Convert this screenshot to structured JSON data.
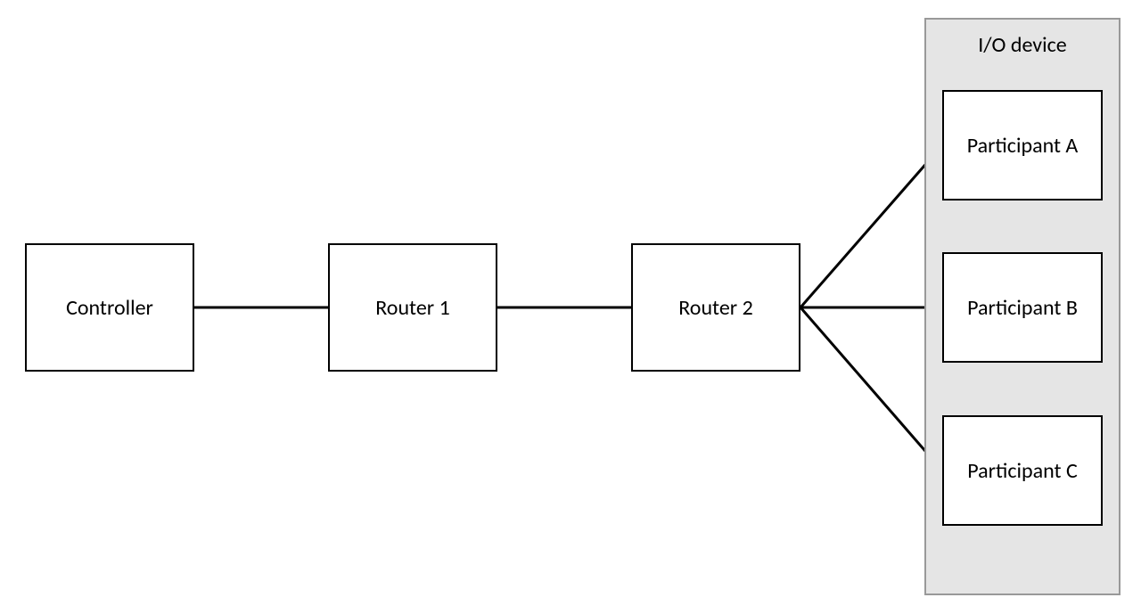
{
  "nodes": {
    "controller": {
      "label": "Controller"
    },
    "router1": {
      "label": "Router 1"
    },
    "router2": {
      "label": "Router 2"
    },
    "participantA": {
      "label": "Participant A"
    },
    "participantB": {
      "label": "Participant B"
    },
    "participantC": {
      "label": "Participant C"
    }
  },
  "ioGroup": {
    "title": "I/O device"
  },
  "edges": [
    {
      "from": "controller",
      "to": "router1"
    },
    {
      "from": "router1",
      "to": "router2"
    },
    {
      "from": "router2",
      "to": "participantA"
    },
    {
      "from": "router2",
      "to": "participantB"
    },
    {
      "from": "router2",
      "to": "participantC"
    }
  ]
}
